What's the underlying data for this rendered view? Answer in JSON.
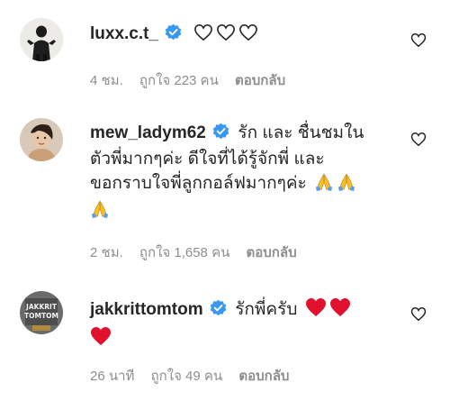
{
  "comments": [
    {
      "username": "luxx.c.t_",
      "text": "",
      "line2": "",
      "line3": "",
      "time": "4 ชม.",
      "likes": "ถูกใจ 223 คน",
      "reply": "ตอบกลับ",
      "emojis": [
        "outline-heart-icon",
        "outline-heart-icon",
        "outline-heart-icon"
      ]
    },
    {
      "username": "mew_ladym62",
      "text": "รัก และ ชื่นชมใน",
      "line2": "ตัวพี่มากๆค่ะ ดีใจที่ได้รู้จักพี่ และ",
      "line3": "ขอกราบใจพี่ลูกกอล์ฟมากๆค่ะ",
      "time": "2 ชม.",
      "likes": "ถูกใจ 1,658 คน",
      "reply": "ตอบกลับ",
      "emojis": [
        "folded-hands-icon",
        "folded-hands-icon",
        "folded-hands-icon"
      ]
    },
    {
      "username": "jakkrittomtom",
      "text": "รักพี่ครับ",
      "line2": "",
      "line3": "",
      "time": "26 นาที",
      "likes": "ถูกใจ 49 คน",
      "reply": "ตอบกลับ",
      "emojis": [
        "red-heart-icon",
        "red-heart-icon",
        "red-heart-icon"
      ]
    }
  ],
  "avatar3_text": [
    "JAKKRIT",
    "TOMTOM"
  ],
  "colors": {
    "verified": "#3897f0",
    "meta": "#8e8e8e",
    "text": "#262626",
    "red_heart": "#e0102e",
    "folded_hands": "#f7c02a"
  }
}
